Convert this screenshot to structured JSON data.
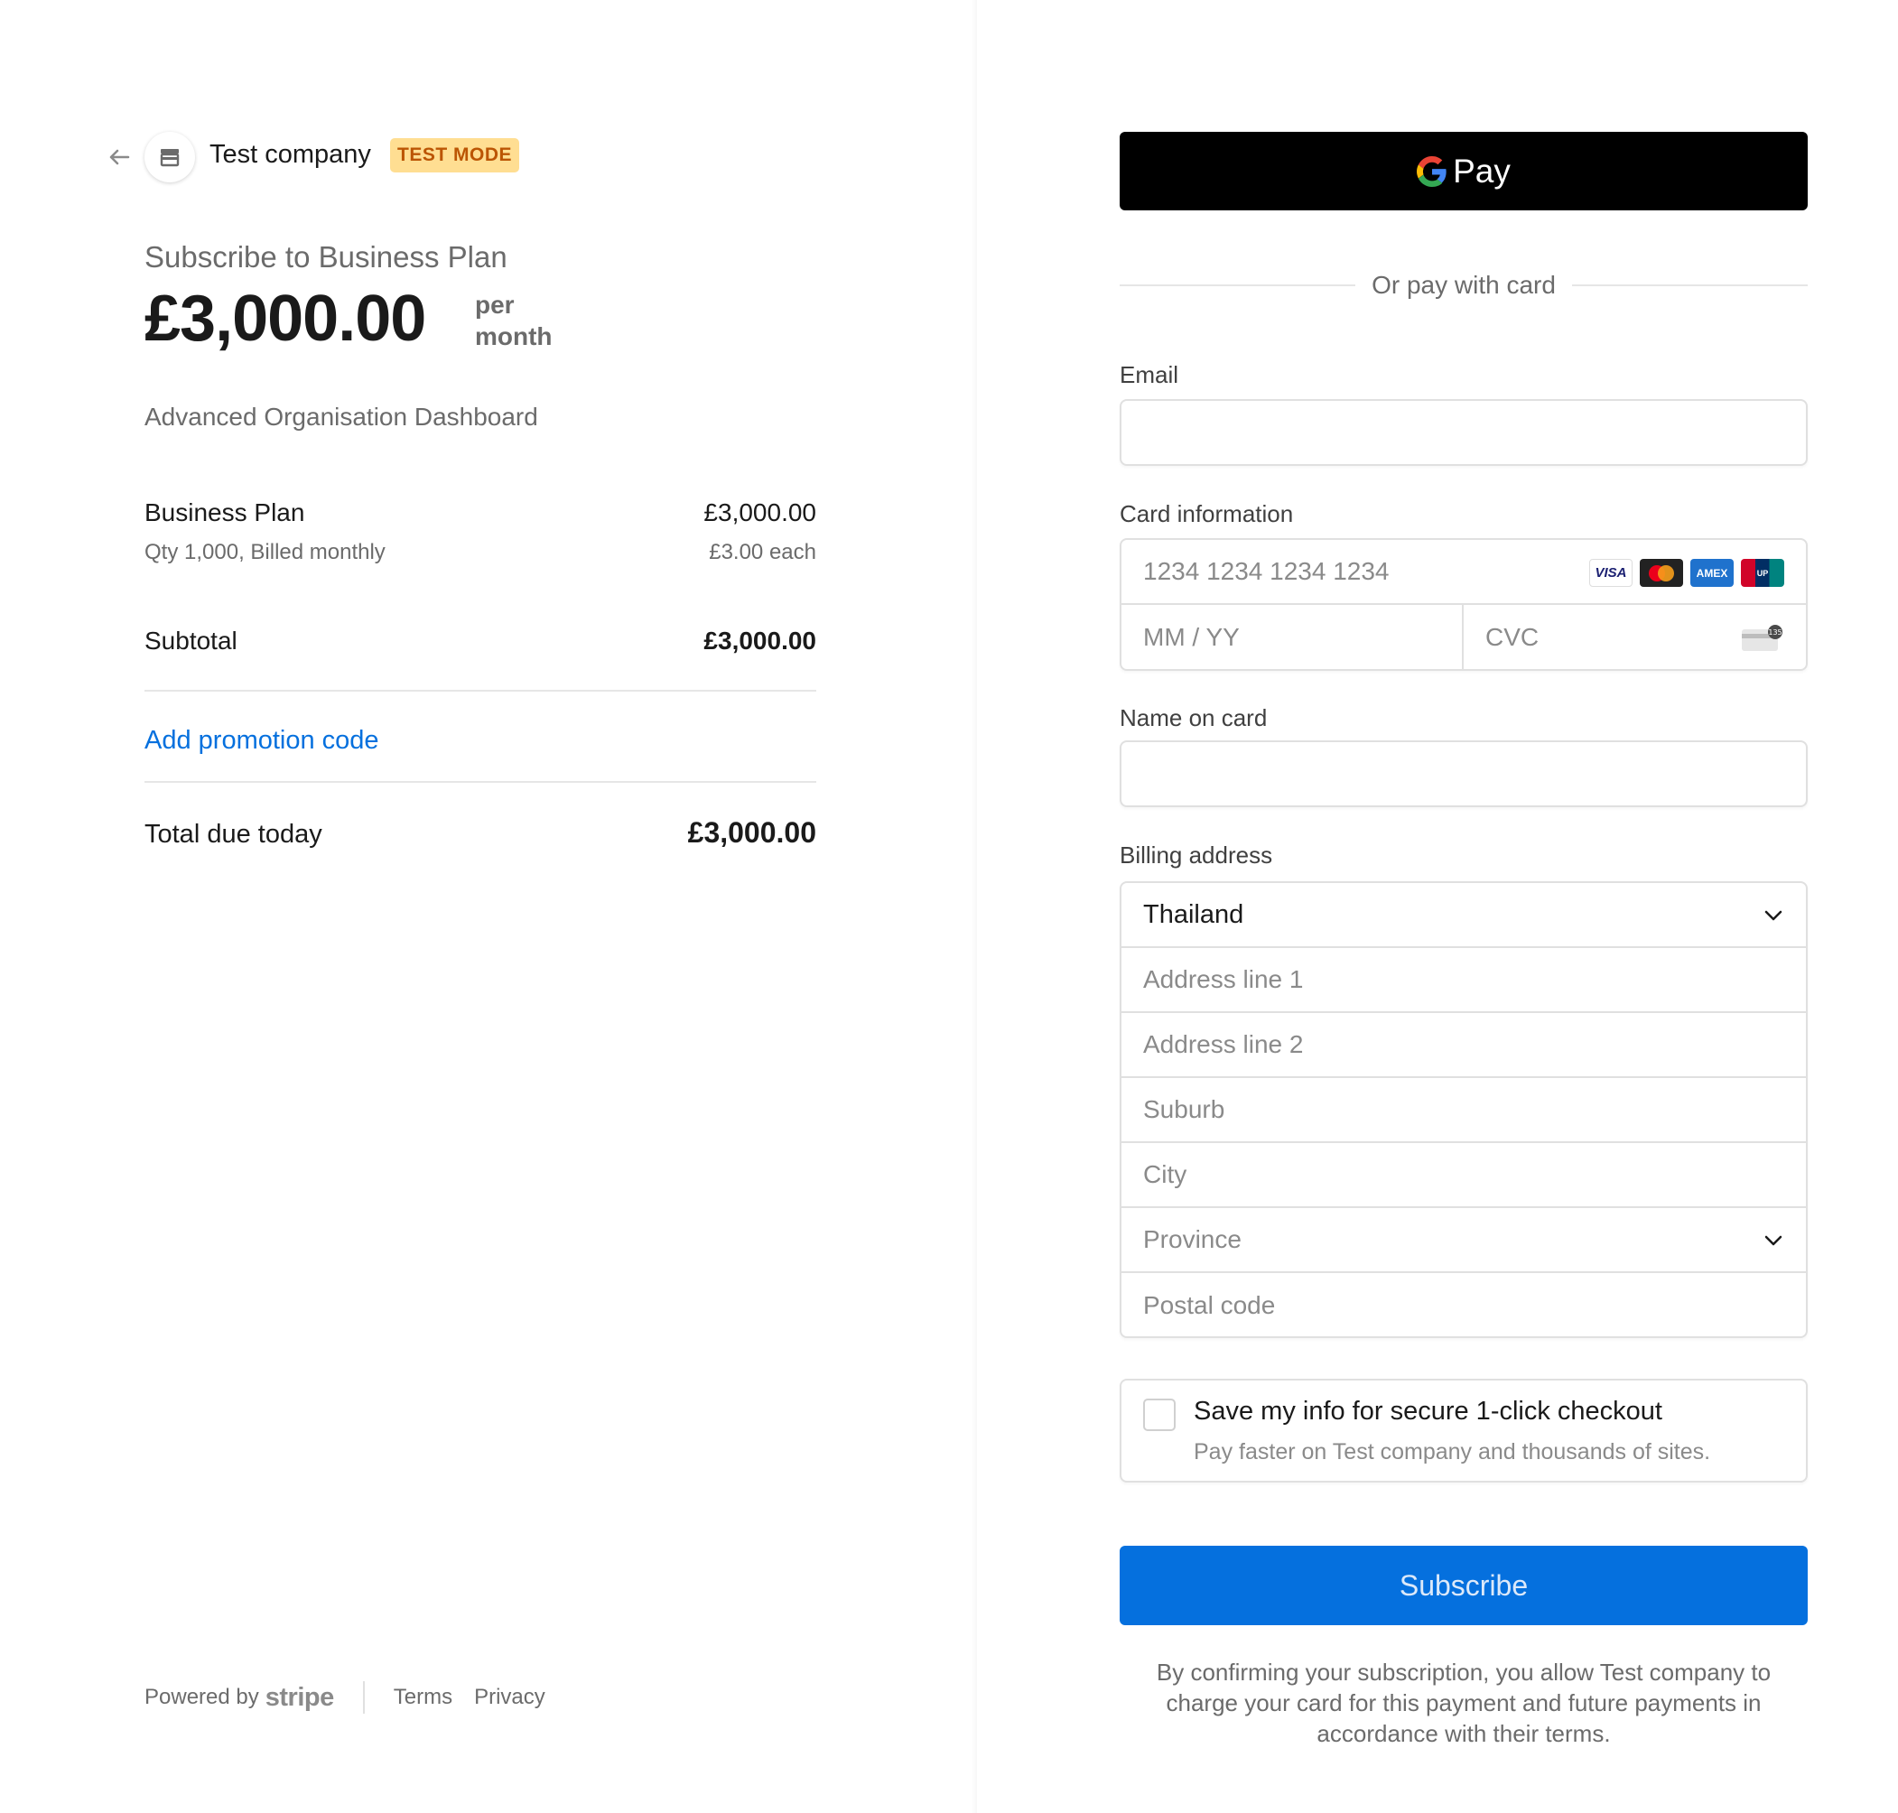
{
  "header": {
    "company_name": "Test company",
    "mode_badge": "TEST MODE"
  },
  "summary": {
    "subscribe_title": "Subscribe to Business Plan",
    "price": "£3,000.00",
    "per": "per",
    "period": "month",
    "description": "Advanced Organisation Dashboard"
  },
  "line_items": [
    {
      "name": "Business Plan",
      "price": "£3,000.00",
      "details": "Qty 1,000, Billed monthly",
      "unit_price": "£3.00 each"
    }
  ],
  "subtotal": {
    "label": "Subtotal",
    "amount": "£3,000.00"
  },
  "promo_link": "Add promotion code",
  "total": {
    "label": "Total due today",
    "amount": "£3,000.00"
  },
  "footer": {
    "powered_by": "Powered by",
    "brand": "stripe",
    "links": [
      "Terms",
      "Privacy"
    ]
  },
  "payment": {
    "gpay_label": "Pay",
    "or_text": "Or pay with card",
    "email_label": "Email",
    "card_label": "Card information",
    "card_number_placeholder": "1234 1234 1234 1234",
    "expiry_placeholder": "MM / YY",
    "cvc_placeholder": "CVC",
    "card_brands": [
      "visa-icon",
      "mastercard-icon",
      "amex-icon",
      "unionpay-icon"
    ],
    "name_label": "Name on card",
    "billing_label": "Billing address",
    "country_value": "Thailand",
    "address_fields": [
      "Address line 1",
      "Address line 2",
      "Suburb",
      "City",
      "Province",
      "Postal code"
    ],
    "save_title": "Save my info for secure 1-click checkout",
    "save_subtitle": "Pay faster on Test company and thousands of sites.",
    "submit_label": "Subscribe",
    "legal_text": "By confirming your subscription, you allow Test company to charge your card for this payment and future payments in accordance with their terms."
  },
  "colors": {
    "accent": "#0570de",
    "badge_bg": "#ffde92",
    "badge_text": "#bb5504"
  }
}
